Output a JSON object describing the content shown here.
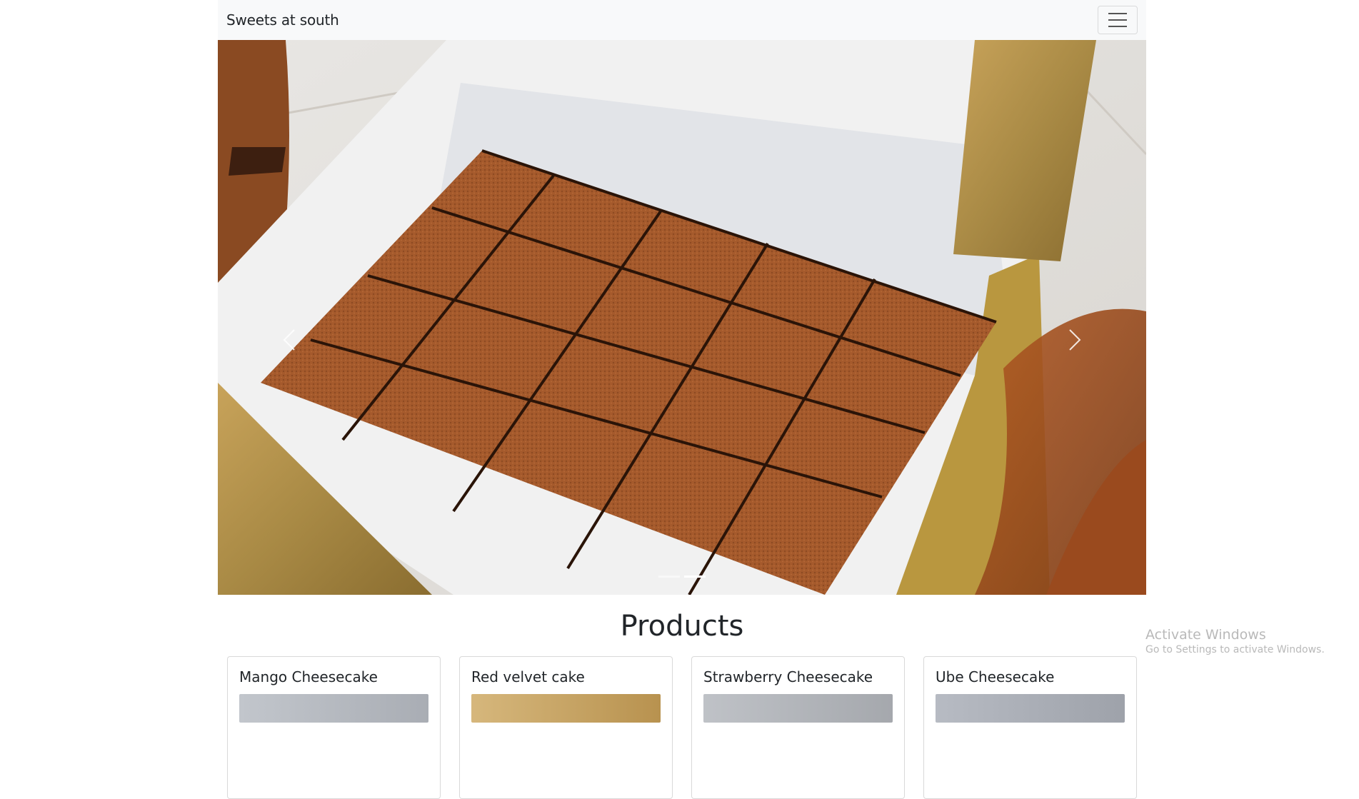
{
  "navbar": {
    "brand": "Sweets at south",
    "toggler_icon": "hamburger-menu-icon"
  },
  "carousel": {
    "prev_icon": "chevron-left-icon",
    "next_icon": "chevron-right-icon",
    "slide_count": 2,
    "active_index": 1
  },
  "products": {
    "heading": "Products",
    "items": [
      {
        "name": "Mango Cheesecake",
        "thumb_color": "#b8bcc4"
      },
      {
        "name": "Red velvet cake",
        "thumb_color": "#c9a66b"
      },
      {
        "name": "Strawberry Cheesecake",
        "thumb_color": "#b3b6bb"
      },
      {
        "name": "Ube Cheesecake",
        "thumb_color": "#aeb2ba"
      }
    ]
  },
  "watermark": {
    "title": "Activate Windows",
    "subtitle": "Go to Settings to activate Windows."
  }
}
